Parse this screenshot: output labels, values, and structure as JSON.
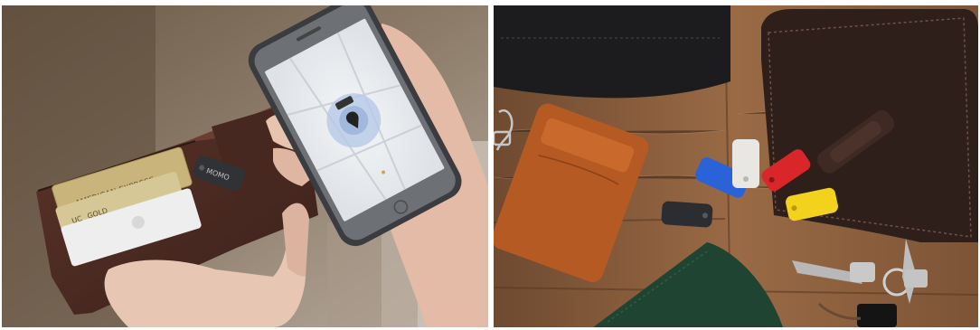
{
  "photos": {
    "left": {
      "card_brand": "AMERICAN EXPRESS",
      "card_tier": "GOLD",
      "card_logo": "UC",
      "card_logo2": "GOLD",
      "tracker_label": "MOMO"
    }
  },
  "colors": {
    "wood": "#8a5a3a",
    "wallet_brown": "#4a2b22",
    "tag_blue": "#2a62d8",
    "tag_red": "#d8262a",
    "tag_yellow": "#f2d21c",
    "tag_white": "#e9e7e3",
    "tag_black": "#2c2d30",
    "card_case_tan": "#b65a24",
    "green_leather": "#1f4532"
  }
}
